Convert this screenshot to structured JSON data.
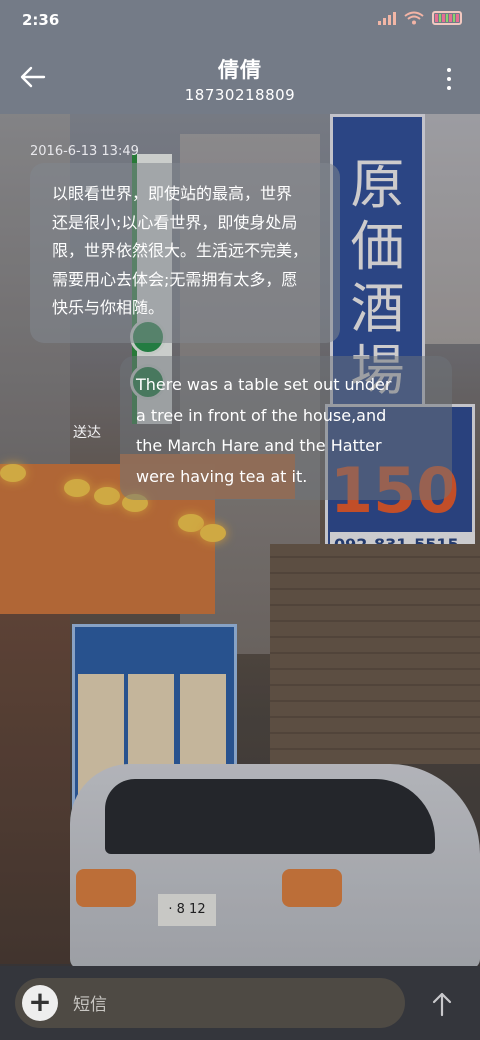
{
  "status_bar": {
    "time": "2:36",
    "icons": [
      "signal-icon",
      "wifi-icon",
      "battery-icon"
    ]
  },
  "header": {
    "back_icon": "arrow-left-icon",
    "contact_name": "倩倩",
    "phone_number": "18730218809",
    "more_icon": "more-vertical-icon"
  },
  "conversation": {
    "timestamp": "2016-6-13 13:49",
    "incoming": {
      "lines": [
        "以眼看世界，即使站的最高，世界",
        "还是很小;以心看世界，即使身处局",
        "限，世界依然很大。生活远不完美，",
        "需要用心去体会;无需拥有太多，愿",
        "快乐与你相随。"
      ]
    },
    "outgoing": {
      "lines": [
        "There was a table set out under",
        "a tree in front of the house,and",
        "the March Hare and the Hatter",
        "were having tea at it."
      ],
      "status": "送达"
    }
  },
  "composer": {
    "add_icon": "plus-icon",
    "add_label": "+",
    "placeholder": "短信",
    "send_icon": "arrow-up-icon"
  },
  "background_text": {
    "sign_vertical": "原価酒場",
    "sign_number": "150",
    "sign_phone": "092-831-5515",
    "plate": "· 8 12"
  },
  "colors": {
    "header_bg": "#747b87",
    "bubble_in": "#82878e",
    "bubble_out": "#6e737a",
    "bottom_bg": "#34363c"
  }
}
